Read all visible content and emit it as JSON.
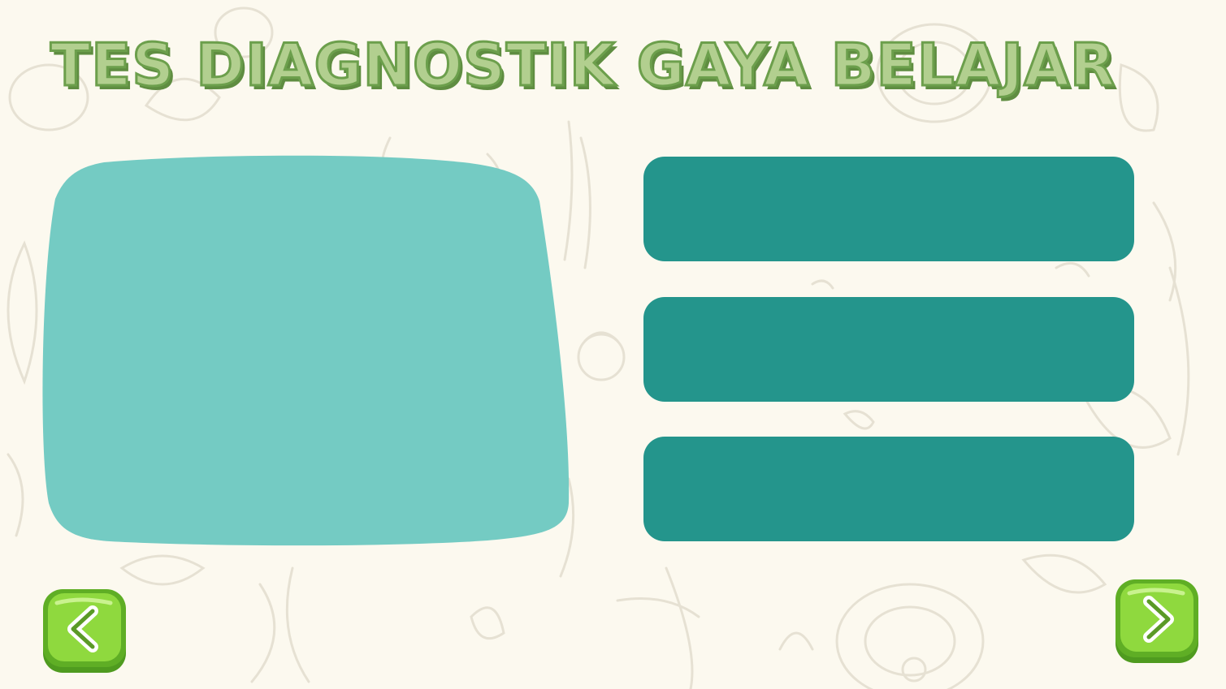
{
  "page": {
    "title": "TES DIAGNOSTIK GAYA BELAJAR"
  },
  "content_panel": {
    "text": ""
  },
  "options": [
    {
      "label": ""
    },
    {
      "label": ""
    },
    {
      "label": ""
    }
  ],
  "navigation": {
    "prev_icon": "chevron-left-icon",
    "next_icon": "chevron-right-icon"
  },
  "colors": {
    "background": "#fcf9ef",
    "title_fill": "#b2cf8f",
    "title_outline": "#6c9f4c",
    "panel": "#74cbc3",
    "option_button": "#24958c",
    "nav_button": "#8fd93e",
    "nav_button_border": "#4f9b1f"
  }
}
